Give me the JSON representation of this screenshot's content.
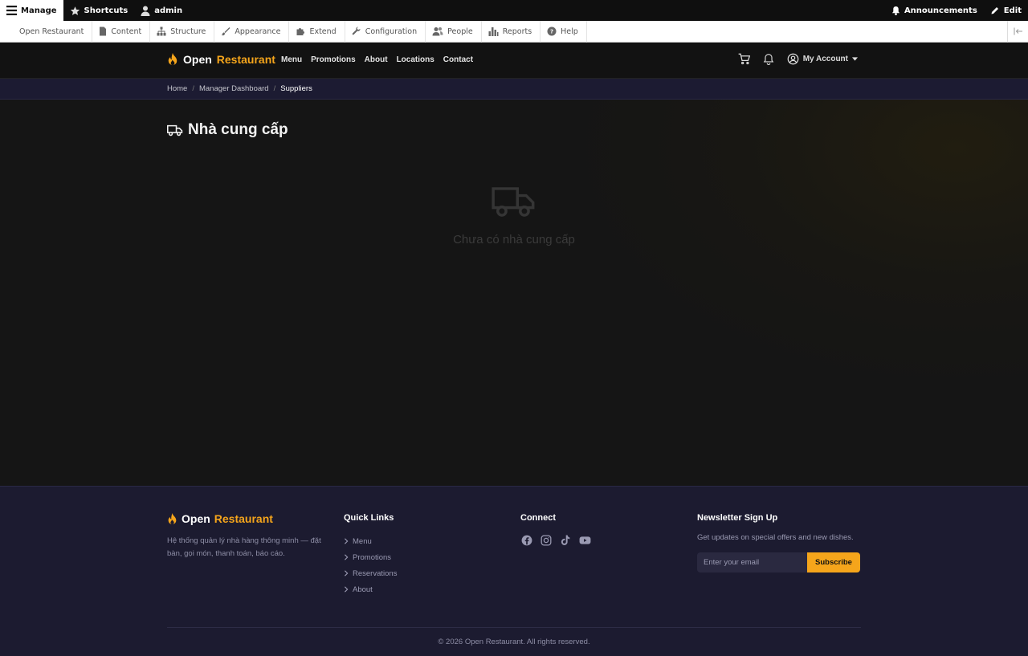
{
  "admin_bar": {
    "manage": "Manage",
    "shortcuts": "Shortcuts",
    "user": "admin",
    "announcements": "Announcements",
    "edit": "Edit"
  },
  "admin_tray": {
    "items": [
      "Open Restaurant",
      "Content",
      "Structure",
      "Appearance",
      "Extend",
      "Configuration",
      "People",
      "Reports",
      "Help"
    ]
  },
  "header": {
    "brand_part1": "Open",
    "brand_part2": "Restaurant",
    "nav": [
      "Menu",
      "Promotions",
      "About",
      "Locations",
      "Contact"
    ],
    "account": "My Account"
  },
  "breadcrumb": [
    "Home",
    "Manager Dashboard",
    "Suppliers"
  ],
  "page": {
    "title": "Nhà cung cấp",
    "empty_text": "Chưa có nhà cung cấp"
  },
  "footer": {
    "brand_part1": "Open",
    "brand_part2": "Restaurant",
    "description": "Hệ thống quản lý nhà hàng thông minh — đặt bàn, gọi món, thanh toán, báo cáo.",
    "quick_links_title": "Quick Links",
    "quick_links": [
      "Menu",
      "Promotions",
      "Reservations",
      "About"
    ],
    "connect_title": "Connect",
    "social_icons": [
      "facebook-icon",
      "instagram-icon",
      "tiktok-icon",
      "youtube-icon"
    ],
    "newsletter_title": "Newsletter Sign Up",
    "newsletter_text": "Get updates on special offers and new dishes.",
    "email_placeholder": "Enter your email",
    "subscribe": "Subscribe",
    "copyright": "© 2026 Open Restaurant. All rights reserved."
  },
  "colors": {
    "accent": "#f5a51b",
    "header_bg": "#121212",
    "footer_bg": "#1c1b30"
  }
}
